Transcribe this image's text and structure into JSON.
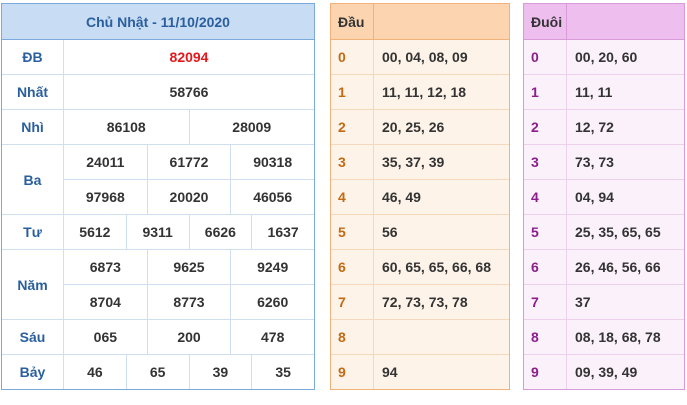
{
  "results": {
    "title": "Chủ Nhật - 11/10/2020",
    "rows": [
      {
        "label": "ĐB",
        "lines": [
          [
            "82094"
          ]
        ]
      },
      {
        "label": "Nhất",
        "lines": [
          [
            "58766"
          ]
        ]
      },
      {
        "label": "Nhì",
        "lines": [
          [
            "86108",
            "28009"
          ]
        ]
      },
      {
        "label": "Ba",
        "lines": [
          [
            "24011",
            "61772",
            "90318"
          ],
          [
            "97968",
            "20020",
            "46056"
          ]
        ]
      },
      {
        "label": "Tư",
        "lines": [
          [
            "5612",
            "9311",
            "6626",
            "1637"
          ]
        ]
      },
      {
        "label": "Năm",
        "lines": [
          [
            "6873",
            "9625",
            "9249"
          ],
          [
            "8704",
            "8773",
            "6260"
          ]
        ]
      },
      {
        "label": "Sáu",
        "lines": [
          [
            "065",
            "200",
            "478"
          ]
        ]
      },
      {
        "label": "Bảy",
        "lines": [
          [
            "46",
            "65",
            "39",
            "35"
          ]
        ]
      }
    ]
  },
  "dau": {
    "header": "Đầu",
    "rows": [
      {
        "key": "0",
        "value": "00, 04, 08, 09"
      },
      {
        "key": "1",
        "value": "11, 11, 12, 18"
      },
      {
        "key": "2",
        "value": "20, 25, 26"
      },
      {
        "key": "3",
        "value": "35, 37, 39"
      },
      {
        "key": "4",
        "value": "46, 49"
      },
      {
        "key": "5",
        "value": "56"
      },
      {
        "key": "6",
        "value": "60, 65, 65, 66, 68"
      },
      {
        "key": "7",
        "value": "72, 73, 73, 78"
      },
      {
        "key": "8",
        "value": ""
      },
      {
        "key": "9",
        "value": "94"
      }
    ]
  },
  "duoi": {
    "header": "Đuôi",
    "rows": [
      {
        "key": "0",
        "value": "00, 20, 60"
      },
      {
        "key": "1",
        "value": "11, 11"
      },
      {
        "key": "2",
        "value": "12, 72"
      },
      {
        "key": "3",
        "value": "73, 73"
      },
      {
        "key": "4",
        "value": "04, 94"
      },
      {
        "key": "5",
        "value": "25, 35, 65, 65"
      },
      {
        "key": "6",
        "value": "26, 46, 56, 66"
      },
      {
        "key": "7",
        "value": "37"
      },
      {
        "key": "8",
        "value": "08, 18, 68, 78"
      },
      {
        "key": "9",
        "value": "09, 39, 49"
      }
    ]
  },
  "colors": {
    "results_border": "#7aa9dd",
    "results_header_bg": "#c8dcf4",
    "label_text": "#2a5f9e",
    "special_prize": "#e3171c",
    "dau_header_bg": "#fcd5b0",
    "dau_key": "#c46a13",
    "duoi_header_bg": "#eebfee",
    "duoi_key": "#8b1e8b"
  }
}
